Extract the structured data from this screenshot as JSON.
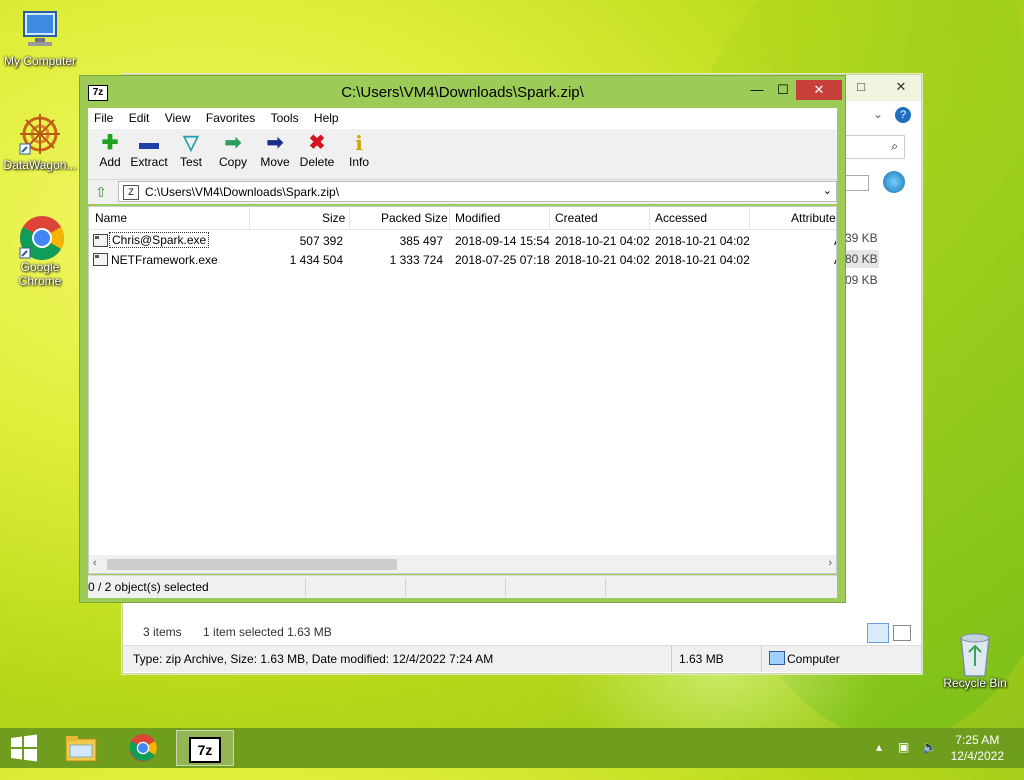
{
  "desktop": {
    "icons": [
      {
        "label": "My Computer",
        "icon": "computer-icon"
      },
      {
        "label": "DataWagon...",
        "icon": "datawagon-icon"
      },
      {
        "label": "Google Chrome",
        "icon": "chrome-icon"
      },
      {
        "label": "Recycle Bin",
        "icon": "recycle-bin-icon"
      }
    ]
  },
  "explorer": {
    "items_count": "3 items",
    "selected_info": "1 item selected  1.63 MB",
    "status_detail": "Type: zip Archive, Size: 1.63 MB, Date modified: 12/4/2022 7:24 AM",
    "status_size": "1.63 MB",
    "status_location": "Computer",
    "side_sizes": [
      "39 KB",
      "80 KB",
      "09 KB"
    ]
  },
  "zip": {
    "title": "C:\\Users\\VM4\\Downloads\\Spark.zip\\",
    "app_icon_text": "7z",
    "menu": [
      "File",
      "Edit",
      "View",
      "Favorites",
      "Tools",
      "Help"
    ],
    "toolbar": [
      {
        "label": "Add",
        "icon": "add-icon",
        "glyph": "✚",
        "color": "#1fa31f"
      },
      {
        "label": "Extract",
        "icon": "extract-icon",
        "glyph": "▬",
        "color": "#1f3fa8"
      },
      {
        "label": "Test",
        "icon": "test-icon",
        "glyph": "✓",
        "color": "#2aa3b0"
      },
      {
        "label": "Copy",
        "icon": "copy-icon",
        "glyph": "➡",
        "color": "#2a9d5a"
      },
      {
        "label": "Move",
        "icon": "move-icon",
        "glyph": "➡",
        "color": "#1b2f8a"
      },
      {
        "label": "Delete",
        "icon": "delete-icon",
        "glyph": "✖",
        "color": "#d4141c"
      },
      {
        "label": "Info",
        "icon": "info-icon",
        "glyph": "i",
        "color": "#c9a600"
      }
    ],
    "address": "C:\\Users\\VM4\\Downloads\\Spark.zip\\",
    "columns": [
      "Name",
      "Size",
      "Packed Size",
      "Modified",
      "Created",
      "Accessed",
      "Attribute"
    ],
    "rows": [
      {
        "name": "Chris@Spark.exe",
        "size": "507 392",
        "packed": "385 497",
        "modified": "2018-09-14 15:54",
        "created": "2018-10-21 04:02",
        "accessed": "2018-10-21 04:02",
        "attr": "A"
      },
      {
        "name": "NETFramework.exe",
        "size": "1 434 504",
        "packed": "1 333 724",
        "modified": "2018-07-25 07:18",
        "created": "2018-10-21 04:02",
        "accessed": "2018-10-21 04:02",
        "attr": "A"
      }
    ],
    "status": "0 / 2 object(s) selected"
  },
  "taskbar": {
    "time": "7:25 AM",
    "date": "12/4/2022",
    "buttons": [
      "start-button",
      "file-explorer-button",
      "chrome-button",
      "7zip-button"
    ]
  },
  "colors": {
    "window_frame": "#9ccc57",
    "taskbar": "#6f9d1e",
    "close_button": "#c7413a"
  }
}
